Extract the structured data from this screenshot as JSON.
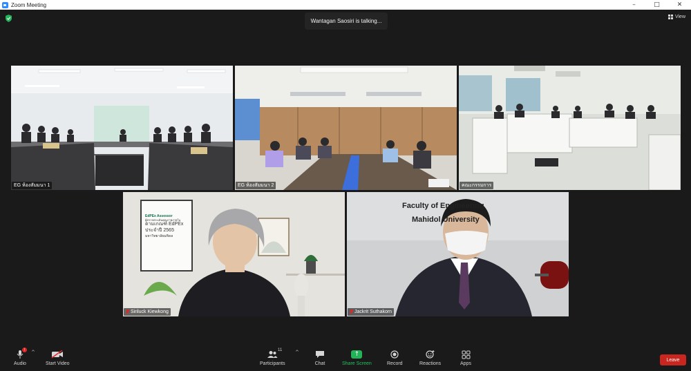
{
  "window": {
    "title": "Zoom Meeting",
    "controls": {
      "minimize": "–",
      "maximize": "□",
      "close": "✕"
    }
  },
  "meeting": {
    "talking_indicator": "Wantagan Saosiri is talking...",
    "view_label": "View",
    "encryption_icon": "shield-icon"
  },
  "participants": [
    {
      "name": "EG ห้องสัมมนา 1",
      "muted": false
    },
    {
      "name": "EG ห้องสัมมนา 2",
      "muted": false
    },
    {
      "name": "คณะกรรมการ",
      "muted": false
    },
    {
      "name": "Siriluck Kiewkong",
      "muted": true
    },
    {
      "name": "Jackrit Suthakorn",
      "muted": true
    }
  ],
  "scene_text": {
    "banner_line1": "Faculty of Engineering",
    "banner_line2": "Mahidol University",
    "tile5_line1": "Faculty of Engineering",
    "tile5_line2": "Mahidol University",
    "poster_brand": "EdPEx Assessor",
    "poster_line1": "ผู้ตรวจประเมินคุณภาพภายใน",
    "poster_line2": "ตามเกณฑ์ EdPEx",
    "poster_line3": "ประจำปี 2565",
    "poster_line4": "มหาวิทยาลัยมหิดล"
  },
  "toolbar": {
    "audio": "Audio",
    "start_video": "Start Video",
    "participants": "Participants",
    "participants_count": "11",
    "chat": "Chat",
    "share_screen": "Share Screen",
    "record": "Record",
    "reactions": "Reactions",
    "apps": "Apps",
    "leave": "Leave",
    "audio_badge": "!"
  },
  "colors": {
    "background": "#1a1a1a",
    "share_green": "#23b45a",
    "leave_red": "#c9261f",
    "zoom_blue": "#2d8cff",
    "muted_red": "#e02828"
  }
}
